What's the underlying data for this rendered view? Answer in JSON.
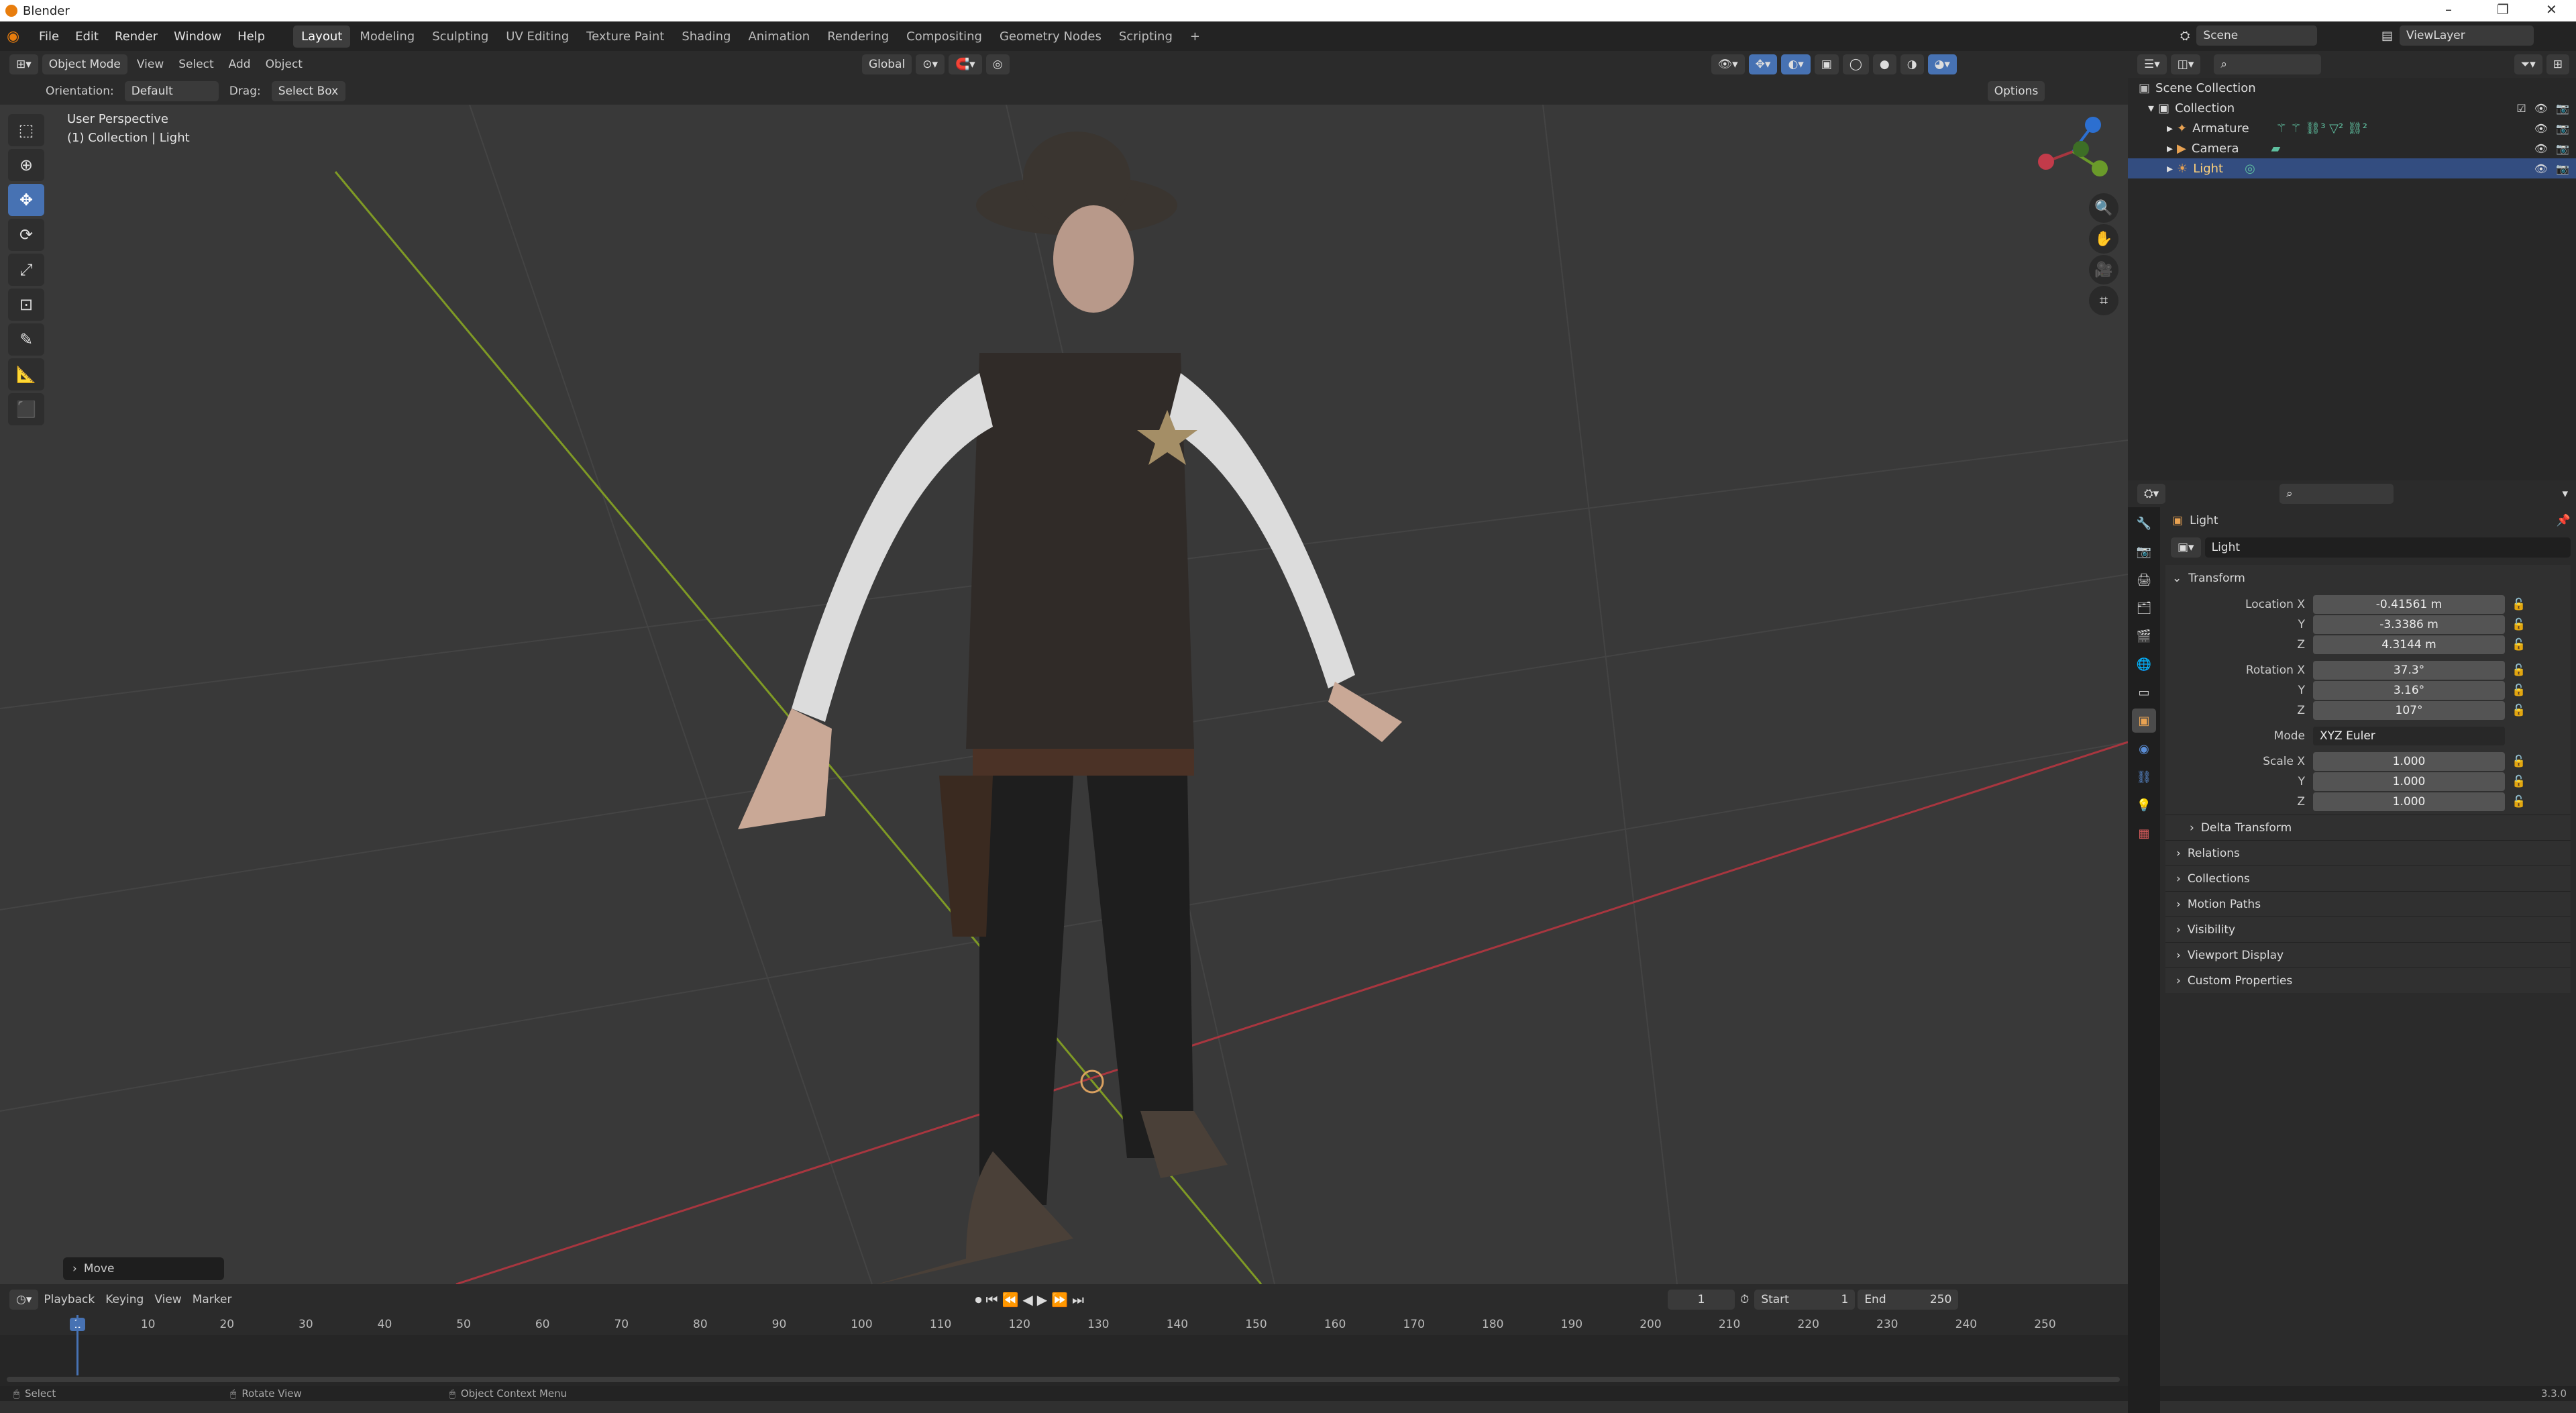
{
  "window": {
    "title": "Blender"
  },
  "menu": {
    "items": [
      "File",
      "Edit",
      "Render",
      "Window",
      "Help"
    ],
    "workspaces": [
      "Layout",
      "Modeling",
      "Sculpting",
      "UV Editing",
      "Texture Paint",
      "Shading",
      "Animation",
      "Rendering",
      "Compositing",
      "Geometry Nodes",
      "Scripting"
    ],
    "active_workspace": "Layout",
    "add_tab": "+"
  },
  "scene": {
    "name": "Scene",
    "view_layer": "ViewLayer"
  },
  "viewport_header": {
    "mode": "Object Mode",
    "menus": [
      "View",
      "Select",
      "Add",
      "Object"
    ],
    "transform_orientation": "Global",
    "orientation_label": "Orientation:",
    "orientation_value": "Default",
    "drag_label": "Drag:",
    "drag_value": "Select Box",
    "options": "Options"
  },
  "viewport": {
    "view_name": "User Perspective",
    "context": "(1) Collection | Light",
    "operator_panel": "Move"
  },
  "timeline": {
    "menus": [
      "Playback",
      "Keying",
      "View",
      "Marker"
    ],
    "current_frame": "1",
    "start_label": "Start",
    "start": "1",
    "end_label": "End",
    "end": "250",
    "ticks": [
      "1",
      "10",
      "20",
      "30",
      "40",
      "50",
      "60",
      "70",
      "80",
      "90",
      "100",
      "110",
      "120",
      "130",
      "140",
      "150",
      "160",
      "170",
      "180",
      "190",
      "200",
      "210",
      "220",
      "230",
      "240",
      "250"
    ]
  },
  "status": {
    "items": [
      "Select",
      "Rotate View",
      "Object Context Menu"
    ],
    "version": "3.3.0"
  },
  "outliner": {
    "root": "Scene Collection",
    "collection": "Collection",
    "objects": [
      {
        "name": "Armature",
        "selected": false
      },
      {
        "name": "Camera",
        "selected": false
      },
      {
        "name": "Light",
        "selected": true
      }
    ]
  },
  "properties": {
    "object_name": "Light",
    "datablock": "Light",
    "transform_title": "Transform",
    "location": {
      "label": "Location X",
      "x": "-0.41561 m",
      "y": "-3.3386 m",
      "z": "4.3144 m"
    },
    "rotation": {
      "label": "Rotation X",
      "x": "37.3°",
      "y": "3.16°",
      "z": "107°"
    },
    "mode_label": "Mode",
    "mode": "XYZ Euler",
    "scale": {
      "label": "Scale X",
      "x": "1.000",
      "y": "1.000",
      "z": "1.000"
    },
    "axis_y": "Y",
    "axis_z": "Z",
    "delta": "Delta Transform",
    "panels": [
      "Relations",
      "Collections",
      "Motion Paths",
      "Visibility",
      "Viewport Display",
      "Custom Properties"
    ]
  },
  "colors": {
    "accent": "#4772b3",
    "selection": "#334d80",
    "x_axis": "#a8363f",
    "y_axis": "#7f9a25"
  }
}
